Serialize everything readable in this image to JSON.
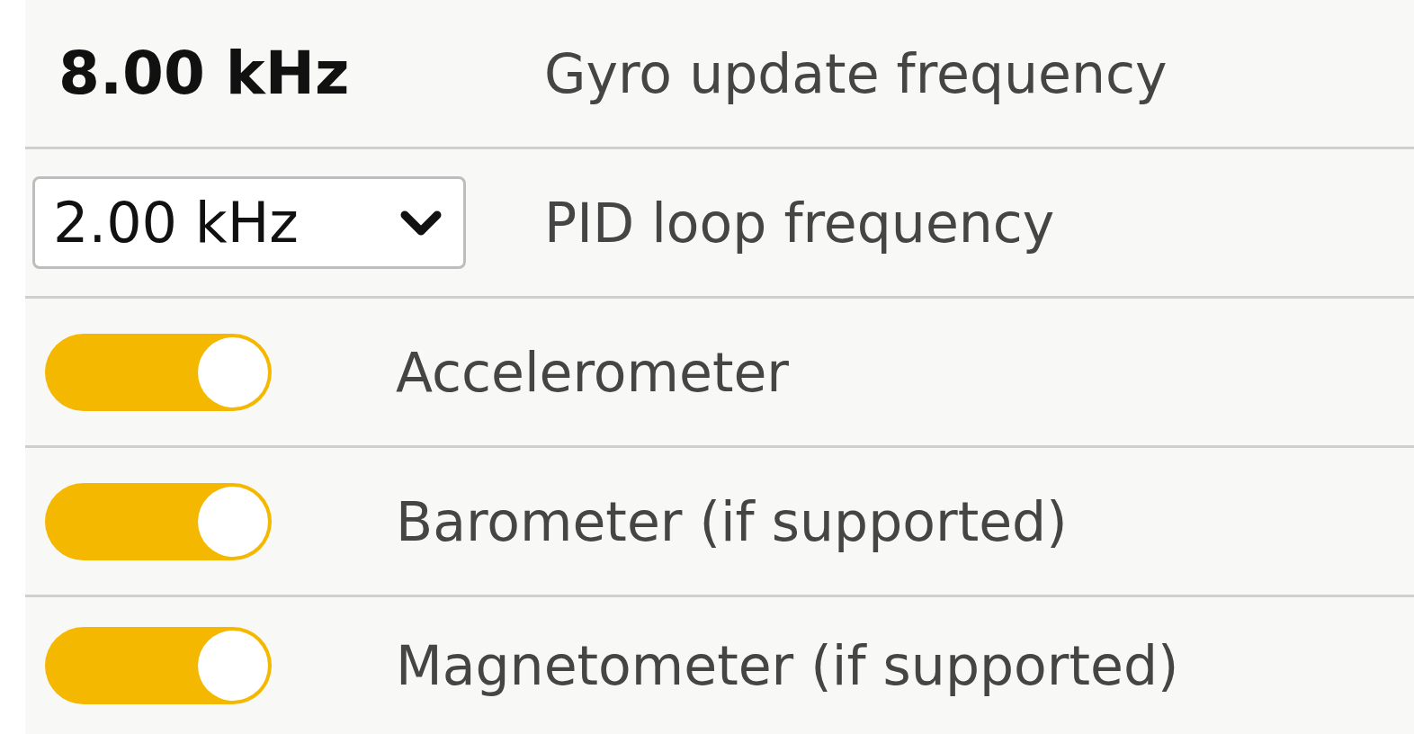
{
  "rows": [
    {
      "kind": "value",
      "value": "8.00 kHz",
      "label": "Gyro update frequency"
    },
    {
      "kind": "select",
      "value": "2.00 kHz",
      "label": "PID loop frequency"
    },
    {
      "kind": "toggle",
      "on": true,
      "label": "Accelerometer"
    },
    {
      "kind": "toggle",
      "on": true,
      "label": "Barometer (if supported)"
    },
    {
      "kind": "toggle",
      "on": true,
      "label": "Magnetometer (if supported)"
    }
  ]
}
